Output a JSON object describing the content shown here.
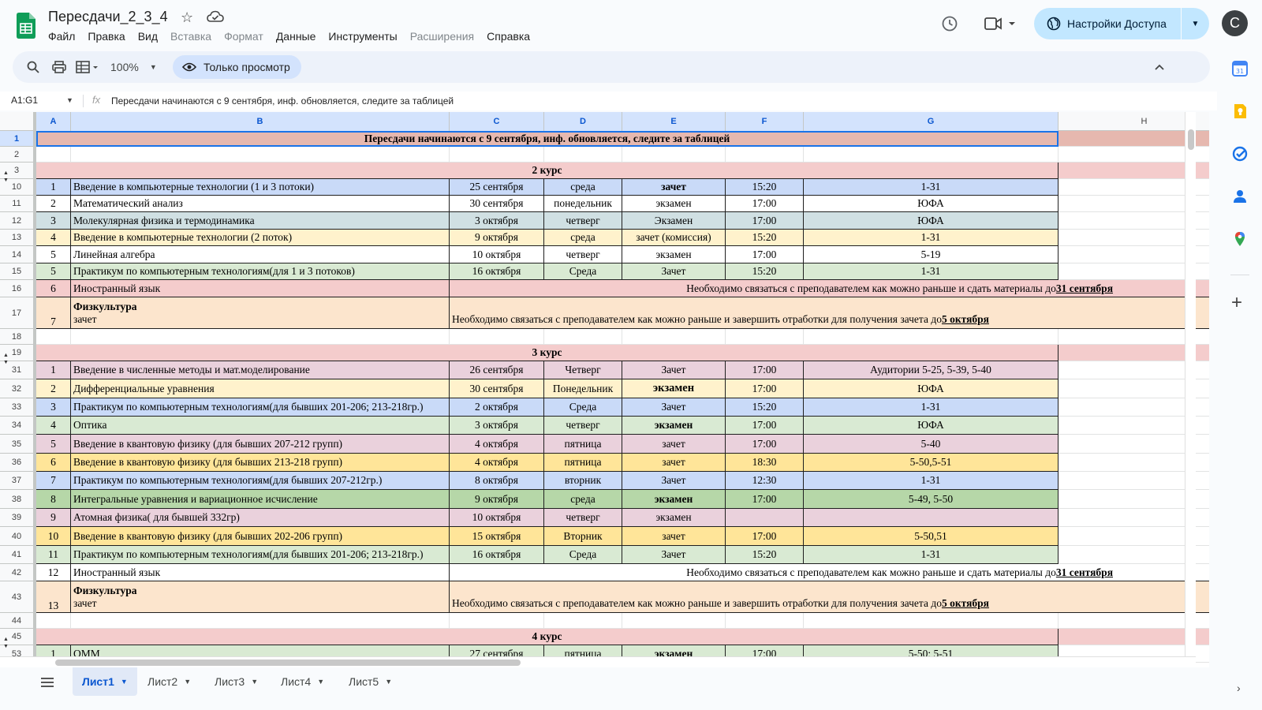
{
  "app": {
    "doc_title": "Пересдачи_2_3_4",
    "menu": [
      {
        "label": "Файл",
        "disabled": false
      },
      {
        "label": "Правка",
        "disabled": false
      },
      {
        "label": "Вид",
        "disabled": false
      },
      {
        "label": "Вставка",
        "disabled": true
      },
      {
        "label": "Формат",
        "disabled": true
      },
      {
        "label": "Данные",
        "disabled": false
      },
      {
        "label": "Инструменты",
        "disabled": false
      },
      {
        "label": "Расширения",
        "disabled": true
      },
      {
        "label": "Справка",
        "disabled": false
      }
    ],
    "share_label": "Настройки Доступа",
    "avatar_letter": "С"
  },
  "toolbar": {
    "zoom": "100%",
    "readonly_label": "Только просмотр"
  },
  "formula_bar": {
    "name_box": "A1:G1",
    "fx_label": "fx",
    "content": "Пересдачи начинаются с 9 сентября, инф. обновляется, следите за таблицей"
  },
  "columns": [
    "A",
    "B",
    "C",
    "D",
    "E",
    "F",
    "G",
    "H"
  ],
  "colors": {
    "salmon": "#e6b8af",
    "pink": "#f4cccc",
    "blue": "#c9daf8",
    "teal": "#d0e0e3",
    "cream": "#fff2cc",
    "green": "#d9ead3",
    "peach": "#fce5cd",
    "rose": "#ead1dc",
    "yellow": "#ffe599",
    "midgreen": "#b6d7a8",
    "white": "#ffffff"
  },
  "rows": [
    {
      "num": "1",
      "type": "title",
      "text": "Пересдачи начинаются с 9 сентября, инф. обновляется, следите за таблицей",
      "bg": "salmon"
    },
    {
      "num": "2",
      "type": "empty"
    },
    {
      "num": "3",
      "type": "section",
      "text": "2 курс",
      "bg": "pink",
      "group": "minus"
    },
    {
      "num": "10",
      "type": "exam",
      "group": "plus",
      "bg": "blue",
      "cells": [
        "1",
        "Введение в компьютерные технологии (1 и 3 потоки)",
        "25 сентября",
        "среда",
        "зачет",
        "15:20",
        "1-31"
      ],
      "bold_e": true
    },
    {
      "num": "11",
      "type": "exam",
      "bg": "white",
      "cells": [
        "2",
        "Математический анализ",
        "30 сентября",
        "понедельник",
        "экзамен",
        "17:00",
        "ЮФА"
      ]
    },
    {
      "num": "12",
      "type": "exam",
      "bg": "teal",
      "cells": [
        "3",
        "Молекулярная физика и термодинамика",
        "3 октября",
        "четверг",
        "Экзамен",
        "17:00",
        "ЮФА"
      ]
    },
    {
      "num": "13",
      "type": "exam",
      "bg": "cream",
      "cells": [
        "4",
        "Введение в компьютерные технологии (2 поток)",
        "9 октября",
        "среда",
        "зачет (комиссия)",
        "15:20",
        "1-31"
      ]
    },
    {
      "num": "14",
      "type": "exam",
      "bg": "white",
      "cells": [
        "5",
        "Линейная алгебра",
        "10 октября",
        "четверг",
        "экзамен",
        "17:00",
        "5-19"
      ]
    },
    {
      "num": "15",
      "type": "exam",
      "bg": "green",
      "cells": [
        "5",
        "Практикум по компьютерным технологиям(для 1 и 3 потоков)",
        "16 октября",
        "Среда",
        "Зачет",
        "15:20",
        "1-31"
      ]
    },
    {
      "num": "16",
      "type": "note",
      "bg": "pink",
      "cells": [
        "6",
        "Иностранный язык"
      ],
      "note": "Необходимо связаться с преподавателем как можно раньше и сдать материалы до ",
      "note_u": "31 сентября"
    },
    {
      "num": "17",
      "type": "fz",
      "bg": "peach",
      "cells": [
        "7",
        "Физкультура",
        "зачет"
      ],
      "note": "Необходимо связаться с преподавателем как можно раньше и завершить отработки для получения зачета до",
      "note_u": " 5 октября"
    },
    {
      "num": "18",
      "type": "empty"
    },
    {
      "num": "19",
      "type": "section",
      "text": "3 курс",
      "bg": "pink",
      "group": "minus"
    },
    {
      "num": "31",
      "type": "exam",
      "group": "plus",
      "bg": "rose",
      "cells": [
        "1",
        "Введение в численные методы и мат.моделирование",
        "26 сентября",
        "Четверг",
        "Зачет",
        "17:00",
        "Аудитории 5-25, 5-39, 5-40"
      ]
    },
    {
      "num": "32",
      "type": "exam",
      "bg": "cream",
      "cells": [
        "2",
        "Дифференциальные уравнения",
        "30 сентября",
        "Понедельник",
        "экзамен",
        "17:00",
        "ЮФА"
      ],
      "bold_e": true,
      "big_e": true
    },
    {
      "num": "33",
      "type": "exam",
      "bg": "blue",
      "cells": [
        "3",
        "Практикум по компьютерным технологиям(для бывших 201-206; 213-218гр.)",
        "2 октября",
        "Среда",
        "Зачет",
        "15:20",
        "1-31"
      ]
    },
    {
      "num": "34",
      "type": "exam",
      "bg": "green",
      "cells": [
        "4",
        "Оптика",
        "3 октября",
        "четверг",
        "экзамен",
        "17:00",
        "ЮФА"
      ],
      "bold_e": true
    },
    {
      "num": "35",
      "type": "exam",
      "bg": "rose",
      "cells": [
        "5",
        "Введение в квантовую физику  (для бывших 207-212 групп)",
        "4 октября",
        "пятница",
        "зачет",
        "17:00",
        "5-40"
      ]
    },
    {
      "num": "36",
      "type": "exam",
      "bg": "yellow",
      "cells": [
        "6",
        "Введение в квантовую физику  (для бывших 213-218 групп)",
        "4 октября",
        "пятница",
        "зачет",
        "18:30",
        "5-50,5-51"
      ]
    },
    {
      "num": "37",
      "type": "exam",
      "bg": "blue",
      "cells": [
        "7",
        "Практикум по компьютерным технологиям(для бывших 207-212гр.)",
        "8 октября",
        "вторник",
        "Зачет",
        "12:30",
        "1-31"
      ]
    },
    {
      "num": "38",
      "type": "exam",
      "bg": "midgreen",
      "cells": [
        "8",
        "Интегральные уравнения и вариационное исчисление",
        "9 октября",
        "среда",
        "экзамен",
        "17:00",
        "5-49, 5-50"
      ],
      "bold_e": true
    },
    {
      "num": "39",
      "type": "exam",
      "bg": "rose",
      "cells": [
        "9",
        "Атомная физика( для бывшей 332гр)",
        "10 октября",
        "четверг",
        "экзамен",
        "",
        ""
      ]
    },
    {
      "num": "40",
      "type": "exam",
      "bg": "yellow",
      "cells": [
        "10",
        "Введение в квантовую физику  (для бывших 202-206 групп)",
        "15 октября",
        "Вторник",
        "зачет",
        "17:00",
        "5-50,51"
      ]
    },
    {
      "num": "41",
      "type": "exam",
      "bg": "green",
      "cells": [
        "11",
        "Практикум по компьютерным технологиям(для бывших 201-206; 213-218гр.)",
        "16 октября",
        "Среда",
        "Зачет",
        "15:20",
        "1-31"
      ]
    },
    {
      "num": "42",
      "type": "note",
      "bg": "white",
      "cells": [
        "12",
        "Иностранный язык"
      ],
      "note": "Необходимо связаться с преподавателем как можно раньше и сдать материалы до ",
      "note_u": "31 сентября"
    },
    {
      "num": "43",
      "type": "fz",
      "bg": "peach",
      "cells": [
        "13",
        "Физкультура",
        "зачет"
      ],
      "note": "Необходимо связаться с преподавателем как можно раньше и завершить отработки для получения зачета до",
      "note_u": " 5 октября"
    },
    {
      "num": "44",
      "type": "empty"
    },
    {
      "num": "45",
      "type": "section",
      "text": "4 курс",
      "bg": "pink",
      "group": "minus"
    },
    {
      "num": "53",
      "type": "exam",
      "group": "plus",
      "bg": "green",
      "cells": [
        "1",
        "ОММ",
        "27 сентября",
        "пятница",
        "экзамен",
        "17:00",
        "5-50; 5-51"
      ],
      "bold_e": true
    }
  ],
  "sheets": [
    {
      "label": "Лист1",
      "active": true
    },
    {
      "label": "Лист2",
      "active": false
    },
    {
      "label": "Лист3",
      "active": false
    },
    {
      "label": "Лист4",
      "active": false
    },
    {
      "label": "Лист5",
      "active": false
    }
  ]
}
